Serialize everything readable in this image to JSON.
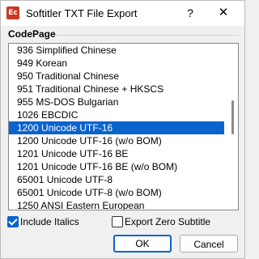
{
  "window": {
    "title": "Softitler TXT File Export",
    "icon_text": "Ec",
    "icon_color": "#c83a24",
    "help_label": "?",
    "close_label": "✕"
  },
  "group": {
    "label": "CodePage"
  },
  "list": {
    "items": [
      {
        "label": "936 Simplified Chinese",
        "selected": false
      },
      {
        "label": "949 Korean",
        "selected": false
      },
      {
        "label": "950 Traditional Chinese",
        "selected": false
      },
      {
        "label": "951 Traditional Chinese + HKSCS",
        "selected": false
      },
      {
        "label": "955 MS-DOS Bulgarian",
        "selected": false
      },
      {
        "label": "1026 EBCDIC",
        "selected": false
      },
      {
        "label": "1200 Unicode UTF-16",
        "selected": true
      },
      {
        "label": "1200 Unicode UTF-16 (w/o BOM)",
        "selected": false
      },
      {
        "label": "1201 Unicode UTF-16 BE",
        "selected": false
      },
      {
        "label": "1201 Unicode UTF-16 BE (w/o BOM)",
        "selected": false
      },
      {
        "label": "65001 Unicode UTF-8",
        "selected": false
      },
      {
        "label": "65001 Unicode UTF-8 (w/o BOM)",
        "selected": false
      },
      {
        "label": "1250 ANSI Eastern European",
        "selected": false
      }
    ],
    "selection_color": "#0a64cc"
  },
  "options": {
    "include_italics": {
      "label": "Include Italics",
      "checked": true
    },
    "export_zero_subtitle": {
      "label": "Export Zero Subtitle",
      "checked": false
    }
  },
  "buttons": {
    "ok": "OK",
    "cancel": "Cancel"
  }
}
